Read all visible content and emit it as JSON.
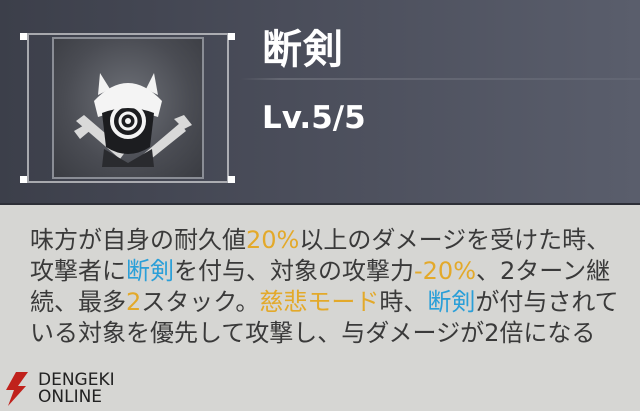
{
  "skill": {
    "name": "断剣",
    "level": "Lv.5/5",
    "icon": "helmet-swords-icon"
  },
  "description": {
    "segments": [
      {
        "text": "味方が自身の耐久値",
        "color": "normal"
      },
      {
        "text": "20%",
        "color": "yellow"
      },
      {
        "text": "以上のダメージを受けた時、攻撃者に",
        "color": "normal"
      },
      {
        "text": "断剣",
        "color": "blue"
      },
      {
        "text": "を付与、対象の攻撃力",
        "color": "normal"
      },
      {
        "text": "-20%",
        "color": "yellow"
      },
      {
        "text": "、2ターン継続、最多",
        "color": "normal"
      },
      {
        "text": "2",
        "color": "yellow"
      },
      {
        "text": "スタック。",
        "color": "normal"
      },
      {
        "text": "慈悲モード",
        "color": "yellow"
      },
      {
        "text": "時、",
        "color": "normal"
      },
      {
        "text": "断剣",
        "color": "blue"
      },
      {
        "text": "が付与されている対象を優先して攻撃し、与ダメージが2倍になる",
        "color": "normal"
      }
    ]
  },
  "watermark": {
    "line1": "DENGEKI",
    "line2": "ONLINE"
  },
  "colors": {
    "highlight_yellow": "#e3a92a",
    "highlight_blue": "#2a9fd8",
    "text": "#3a3a3a"
  }
}
